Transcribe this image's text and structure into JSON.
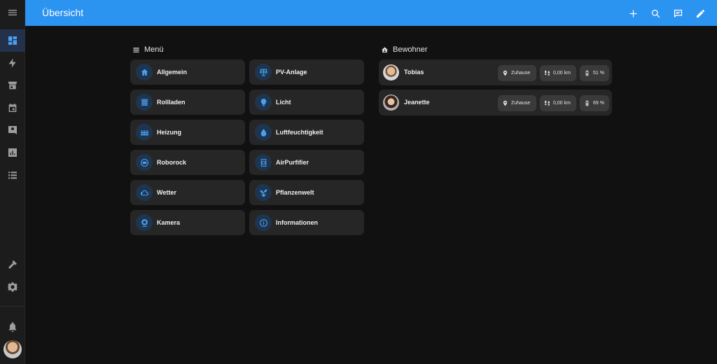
{
  "header": {
    "title": "Übersicht"
  },
  "sidebar": {
    "items": [
      {
        "name": "sidebar-menu-toggle",
        "icon": "menu-icon"
      },
      {
        "name": "sidebar-item-overview",
        "icon": "dashboard-icon",
        "active": true
      },
      {
        "name": "sidebar-item-energy",
        "icon": "lightning-icon"
      },
      {
        "name": "sidebar-item-store",
        "icon": "store-icon"
      },
      {
        "name": "sidebar-item-calendar",
        "icon": "calendar-icon"
      },
      {
        "name": "sidebar-item-contacts",
        "icon": "account-box-icon"
      },
      {
        "name": "sidebar-item-history",
        "icon": "chart-icon"
      },
      {
        "name": "sidebar-item-logbook",
        "icon": "list-icon"
      },
      {
        "name": "sidebar-item-developer-tools",
        "icon": "hammer-icon"
      },
      {
        "name": "sidebar-item-settings",
        "icon": "gear-icon"
      },
      {
        "name": "sidebar-item-notifications",
        "icon": "bell-icon"
      }
    ]
  },
  "menu": {
    "title": "Menü",
    "tiles": [
      {
        "label": "Allgemein",
        "icon": "home-icon"
      },
      {
        "label": "PV-Anlage",
        "icon": "solar-panel-icon"
      },
      {
        "label": "Rollladen",
        "icon": "blinds-icon"
      },
      {
        "label": "Licht",
        "icon": "lightbulb-icon"
      },
      {
        "label": "Heizung",
        "icon": "radiator-icon"
      },
      {
        "label": "Luftfeuchtigkeit",
        "icon": "water-drop-icon"
      },
      {
        "label": "Roborock",
        "icon": "robot-vacuum-icon"
      },
      {
        "label": "AirPurfifier",
        "icon": "air-purifier-icon"
      },
      {
        "label": "Wetter",
        "icon": "weather-icon"
      },
      {
        "label": "Pflanzenwelt",
        "icon": "sprout-icon"
      },
      {
        "label": "Kamera",
        "icon": "webcam-icon"
      },
      {
        "label": "Informationen",
        "icon": "info-icon"
      }
    ]
  },
  "residents": {
    "title": "Bewohner",
    "people": [
      {
        "name": "Tobias",
        "location": "Zuhause",
        "distance": "0,00 km",
        "battery": "51 %"
      },
      {
        "name": "Jeanette",
        "location": "Zuhause",
        "distance": "0,00 km",
        "battery": "69 %"
      }
    ]
  },
  "colors": {
    "accent": "#2b93f0",
    "background": "#111111",
    "card": "#262626",
    "icon_accent": "#4aa0f0"
  }
}
